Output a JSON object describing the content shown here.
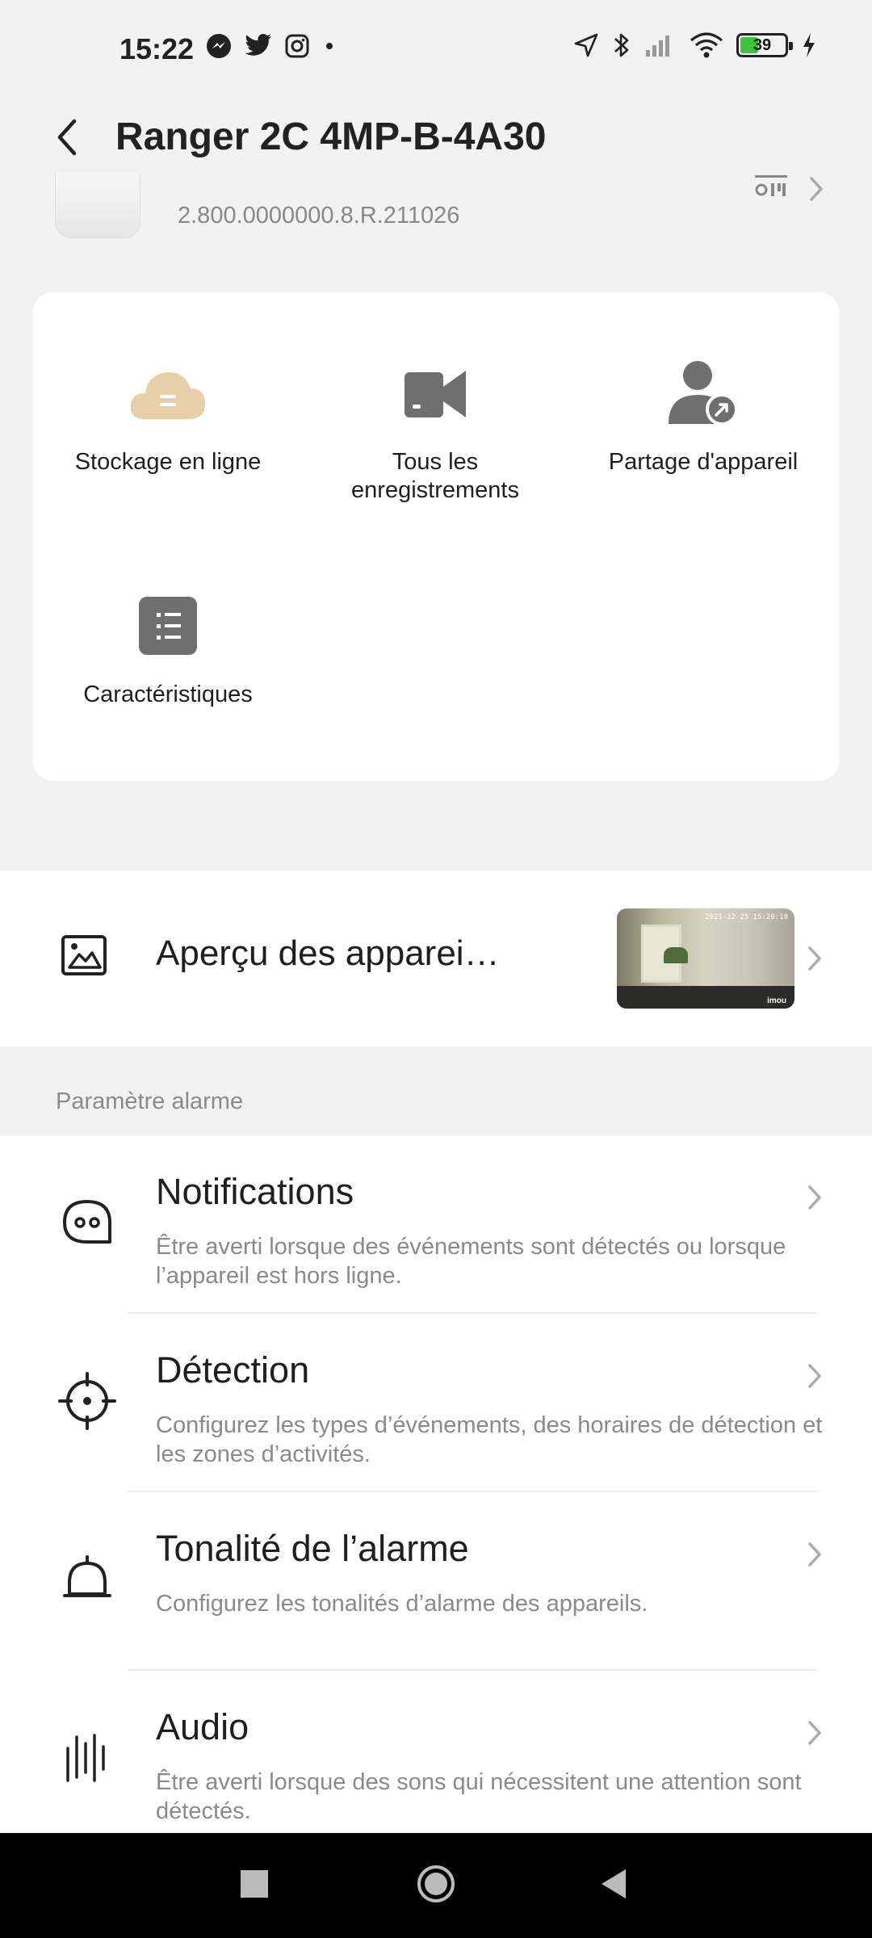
{
  "status_bar": {
    "time": "15:22",
    "left_icons": [
      "messenger-icon",
      "twitter-icon",
      "instagram-icon",
      "dot-icon"
    ],
    "right_icons": [
      "location-icon",
      "bluetooth-icon",
      "signal-icon",
      "wifi-icon",
      "battery-icon",
      "charging-icon"
    ],
    "battery_level": "39"
  },
  "header": {
    "title": "Ranger 2C 4MP-B-4A30"
  },
  "device": {
    "version": "2.800.0000000.8.R.211026"
  },
  "features": [
    {
      "label": "Stockage en ligne",
      "icon": "cloud-storage-icon",
      "color": "#e9ceaa"
    },
    {
      "label": "Tous les enregistrements",
      "icon": "video-camera-icon",
      "color": "#6f6f6f"
    },
    {
      "label": "Partage d'appareil",
      "icon": "share-user-icon",
      "color": "#6f6f6f"
    },
    {
      "label": "Caractéristiques",
      "icon": "features-list-icon",
      "color": "#6f6f6f"
    }
  ],
  "preview": {
    "label": "Aperçu des apparei…",
    "thumb_stamp": "2021-12-25 15:20:10",
    "thumb_logo": "imou"
  },
  "alarm_section": {
    "title": "Paramètre alarme"
  },
  "settings": [
    {
      "title": "Notifications",
      "desc": "Être averti lorsque des événements sont détectés ou lorsque l’appareil est hors ligne.",
      "icon": "notification-bubble-icon"
    },
    {
      "title": "Détection",
      "desc": "Configurez les types d’événements, des horaires de détection et les zones d’activités.",
      "icon": "crosshair-icon"
    },
    {
      "title": "Tonalité de l’alarme",
      "desc": "Configurez les tonalités d’alarme des appareils.",
      "icon": "bell-icon"
    },
    {
      "title": "Audio",
      "desc": "Être averti lorsque des sons qui nécessitent une attention sont détectés.",
      "icon": "sound-wave-icon"
    }
  ],
  "colors": {
    "background": "#f2f2f2",
    "card": "#ffffff",
    "accent_cloud": "#e9ceaa",
    "icon_gray": "#6f6f6f",
    "secondary_text": "#8a8a8a"
  }
}
